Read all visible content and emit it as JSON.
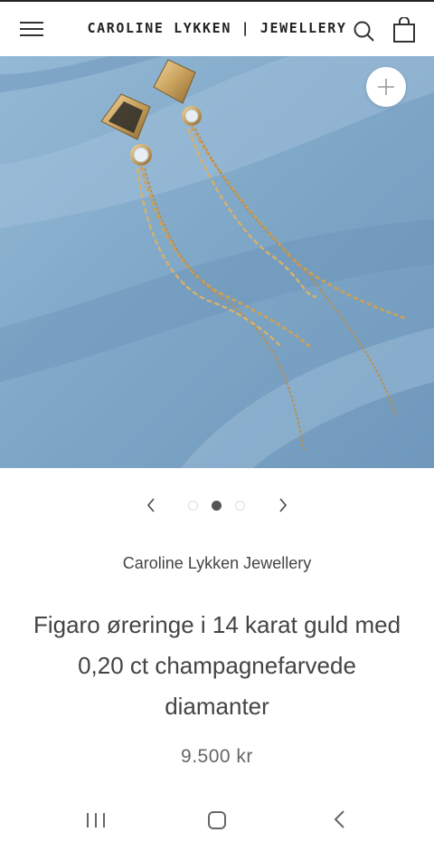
{
  "header": {
    "brand": "CAROLINE LYKKEN | JEWELLERY",
    "menu_icon": "hamburger-menu-icon",
    "search_icon": "search-icon",
    "cart_icon": "shopping-bag-icon"
  },
  "gallery": {
    "zoom_icon": "plus-icon",
    "prev_icon": "chevron-left-icon",
    "next_icon": "chevron-right-icon",
    "slide_count": 3,
    "active_slide": 2
  },
  "product": {
    "vendor": "Caroline Lykken Jewellery",
    "title": "Figaro øreringe i 14 karat guld med 0,20 ct champagnefarvede diamanter",
    "price": "9.500 kr"
  },
  "system_nav": {
    "recents_icon": "recent-apps-icon",
    "home_icon": "home-icon",
    "back_icon": "back-icon"
  },
  "colors": {
    "fabric": "#7fa6c7",
    "gold": "#c9a15c",
    "text": "#444444"
  }
}
